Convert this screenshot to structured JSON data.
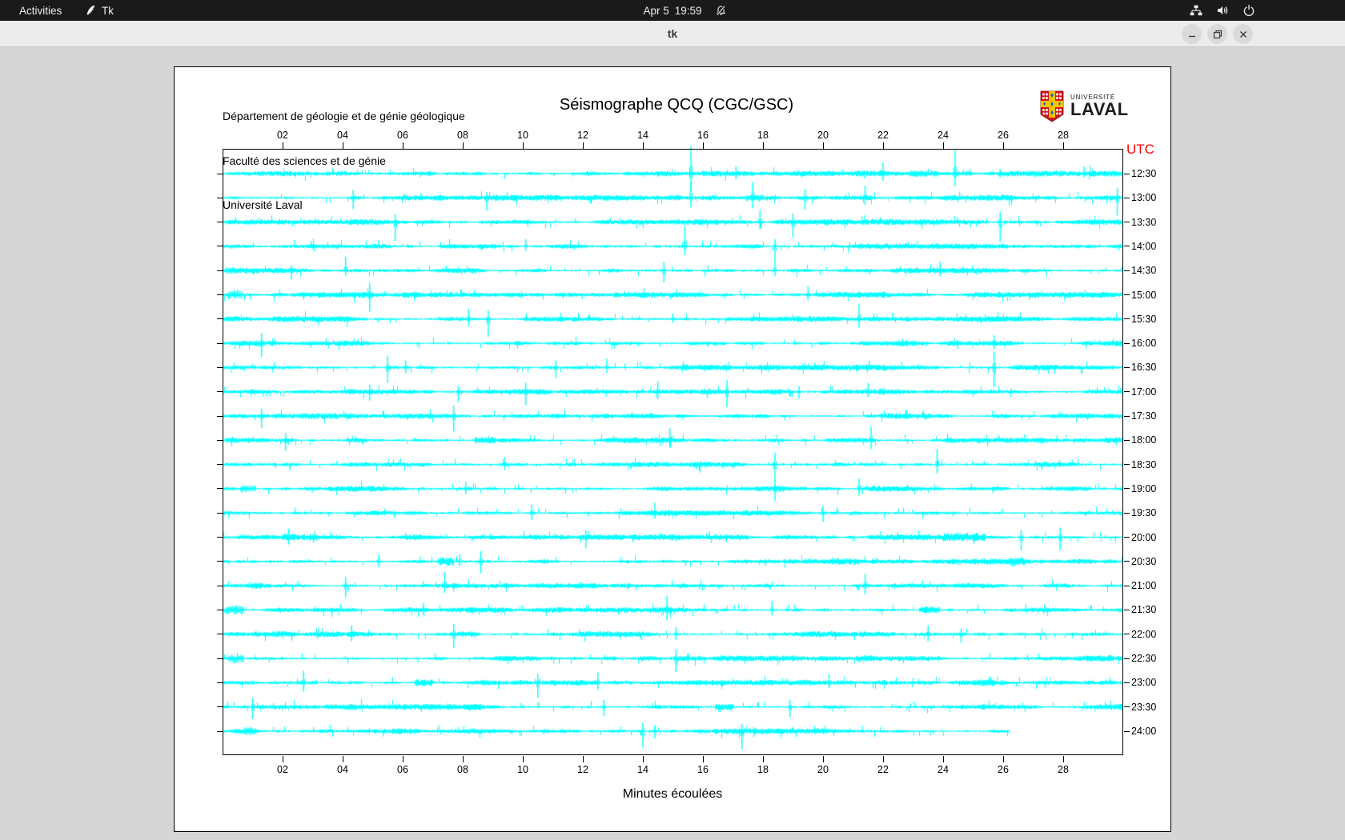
{
  "topbar": {
    "activities_label": "Activities",
    "app_indicator_label": "Tk",
    "clock_date": "Apr 5",
    "clock_time": "19:59",
    "icons": [
      "tk-feather-icon",
      "notifications-disabled-icon",
      "network-icon",
      "volume-icon",
      "power-icon"
    ]
  },
  "titlebar": {
    "title": "tk",
    "buttons": [
      "minimize",
      "maximize",
      "close"
    ]
  },
  "panel": {
    "header_lines": [
      "Département de géologie et de génie géologique",
      "Faculté des sciences et de génie",
      "Université Laval"
    ],
    "logo": {
      "university": "UNIVERSITÉ",
      "name": "LAVAL"
    },
    "title": "Séismographe QCQ (CGC/GSC)",
    "utc_label": "UTC",
    "xlabel": "Minutes écoulées"
  },
  "colors": {
    "desktop_bg": "#d6d6d6",
    "topbar_bg": "#1a1a1a",
    "titlebar_bg": "#ececec",
    "panel_bg": "#ffffff",
    "trace": "#00ffff",
    "utc_label": "#fb0007",
    "logo_red": "#d8101b",
    "logo_gold": "#f7c500",
    "logo_blue": "#1d6fb8"
  },
  "chart_data": {
    "type": "line",
    "subtype": "helicorder-seismograph",
    "title": "Séismographe QCQ (CGC/GSC)",
    "xlabel": "Minutes écoulées",
    "right_axis_label": "UTC",
    "x_range": [
      0,
      30
    ],
    "x_ticks": [
      "02",
      "04",
      "06",
      "08",
      "10",
      "12",
      "14",
      "16",
      "18",
      "20",
      "22",
      "24",
      "26",
      "28"
    ],
    "grid": false,
    "trace_color": "#00ffff",
    "noise_seed": 1234,
    "rows": [
      {
        "utc": "12:30",
        "spikes": [
          [
            15.6,
            34,
            22
          ],
          [
            17.1,
            9,
            7
          ],
          [
            22.0,
            14,
            9
          ],
          [
            24.4,
            30,
            16
          ],
          [
            25.9,
            6,
            5
          ],
          [
            28.7,
            9,
            5
          ]
        ],
        "bursts": [
          [
            22.9,
            0.9,
            4
          ]
        ]
      },
      {
        "utc": "13:00",
        "spikes": [
          [
            4.35,
            10,
            14
          ],
          [
            8.8,
            7,
            16
          ],
          [
            15.6,
            20,
            12
          ],
          [
            17.65,
            20,
            13
          ],
          [
            19.4,
            11,
            15
          ],
          [
            21.4,
            15,
            9
          ],
          [
            29.8,
            12,
            22
          ]
        ],
        "bursts": [
          [
            17.4,
            0.6,
            4
          ]
        ]
      },
      {
        "utc": "13:30",
        "spikes": [
          [
            5.75,
            10,
            24
          ],
          [
            17.9,
            15,
            9
          ],
          [
            19.0,
            11,
            19
          ],
          [
            25.9,
            13,
            25
          ]
        ],
        "bursts": []
      },
      {
        "utc": "14:00",
        "spikes": [
          [
            10.1,
            9,
            6
          ],
          [
            15.4,
            25,
            11
          ],
          [
            18.4,
            9,
            17
          ]
        ],
        "bursts": []
      },
      {
        "utc": "14:30",
        "spikes": [
          [
            2.3,
            7,
            11
          ],
          [
            4.1,
            17,
            6
          ],
          [
            14.7,
            11,
            15
          ],
          [
            18.4,
            13,
            7
          ],
          [
            23.9,
            11,
            7
          ]
        ],
        "bursts": [
          [
            0.1,
            0.5,
            4
          ]
        ]
      },
      {
        "utc": "15:00",
        "spikes": [
          [
            4.9,
            15,
            21
          ],
          [
            19.5,
            11,
            7
          ]
        ],
        "bursts": [
          [
            0.15,
            0.5,
            5
          ]
        ]
      },
      {
        "utc": "15:30",
        "spikes": [
          [
            8.2,
            13,
            9
          ],
          [
            8.85,
            11,
            22
          ],
          [
            15.0,
            7,
            5
          ],
          [
            21.2,
            19,
            11
          ]
        ],
        "bursts": []
      },
      {
        "utc": "16:00",
        "spikes": [
          [
            1.3,
            13,
            17
          ],
          [
            25.7,
            10,
            7
          ]
        ],
        "bursts": []
      },
      {
        "utc": "16:30",
        "spikes": [
          [
            5.5,
            15,
            19
          ],
          [
            6.1,
            9,
            7
          ],
          [
            11.1,
            9,
            13
          ],
          [
            12.8,
            11,
            7
          ],
          [
            25.7,
            20,
            24
          ]
        ],
        "bursts": []
      },
      {
        "utc": "17:00",
        "spikes": [
          [
            4.9,
            9,
            11
          ],
          [
            7.85,
            7,
            13
          ],
          [
            10.1,
            11,
            17
          ],
          [
            14.5,
            13,
            9
          ],
          [
            16.8,
            15,
            19
          ],
          [
            19.2,
            7,
            9
          ],
          [
            21.5,
            11,
            7
          ]
        ],
        "bursts": []
      },
      {
        "utc": "17:30",
        "spikes": [
          [
            1.3,
            9,
            15
          ],
          [
            7.7,
            13,
            19
          ]
        ],
        "bursts": []
      },
      {
        "utc": "18:00",
        "spikes": [
          [
            2.1,
            9,
            13
          ],
          [
            14.9,
            15,
            9
          ],
          [
            21.6,
            17,
            11
          ]
        ],
        "bursts": [
          [
            8.4,
            0.7,
            4
          ],
          [
            0.1,
            0.4,
            3
          ]
        ]
      },
      {
        "utc": "18:30",
        "spikes": [
          [
            9.4,
            9,
            7
          ],
          [
            18.4,
            15,
            21
          ],
          [
            23.8,
            19,
            11
          ]
        ],
        "bursts": []
      },
      {
        "utc": "19:00",
        "spikes": [
          [
            8.1,
            9,
            7
          ],
          [
            18.4,
            11,
            15
          ],
          [
            21.2,
            13,
            9
          ]
        ],
        "bursts": [
          [
            0.6,
            0.5,
            4
          ]
        ]
      },
      {
        "utc": "19:30",
        "spikes": [
          [
            10.3,
            11,
            9
          ],
          [
            14.4,
            13,
            7
          ],
          [
            20.0,
            9,
            11
          ]
        ],
        "bursts": []
      },
      {
        "utc": "20:00",
        "spikes": [
          [
            2.2,
            11,
            9
          ],
          [
            12.1,
            9,
            13
          ],
          [
            26.6,
            9,
            17
          ],
          [
            27.9,
            12,
            16
          ]
        ],
        "bursts": [
          [
            24.0,
            1.4,
            5
          ]
        ]
      },
      {
        "utc": "20:30",
        "spikes": [
          [
            5.2,
            9,
            7
          ],
          [
            7.9,
            9,
            6
          ],
          [
            8.6,
            13,
            15
          ]
        ],
        "bursts": [
          [
            7.2,
            0.5,
            5
          ],
          [
            26.2,
            0.5,
            5
          ]
        ]
      },
      {
        "utc": "21:00",
        "spikes": [
          [
            4.1,
            11,
            15
          ],
          [
            7.4,
            17,
            9
          ],
          [
            21.4,
            15,
            11
          ]
        ],
        "bursts": []
      },
      {
        "utc": "21:30",
        "spikes": [
          [
            6.7,
            9,
            7
          ],
          [
            14.8,
            17,
            13
          ],
          [
            18.3,
            11,
            7
          ]
        ],
        "bursts": [
          [
            0.1,
            0.6,
            5
          ],
          [
            23.2,
            0.7,
            4
          ]
        ]
      },
      {
        "utc": "22:00",
        "spikes": [
          [
            4.3,
            11,
            9
          ],
          [
            7.7,
            13,
            17
          ],
          [
            15.1,
            9,
            7
          ],
          [
            23.5,
            11,
            9
          ],
          [
            24.6,
            7,
            11
          ]
        ],
        "bursts": []
      },
      {
        "utc": "22:30",
        "spikes": [
          [
            15.1,
            11,
            17
          ],
          [
            15.5,
            7,
            5
          ]
        ],
        "bursts": [
          [
            0.2,
            0.5,
            5
          ],
          [
            21.1,
            0.6,
            4
          ]
        ]
      },
      {
        "utc": "23:00",
        "spikes": [
          [
            2.7,
            15,
            11
          ],
          [
            10.5,
            11,
            19
          ],
          [
            12.5,
            13,
            9
          ],
          [
            20.2,
            11,
            7
          ]
        ],
        "bursts": [
          [
            6.4,
            0.6,
            4
          ],
          [
            25.0,
            0.7,
            4
          ]
        ]
      },
      {
        "utc": "23:30",
        "spikes": [
          [
            1.0,
            11,
            15
          ],
          [
            12.7,
            9,
            11
          ],
          [
            18.9,
            9,
            13
          ]
        ],
        "bursts": [
          [
            8.0,
            0.6,
            4
          ],
          [
            16.4,
            0.6,
            4
          ]
        ]
      },
      {
        "utc": "24:00",
        "end": 26.2,
        "spikes": [
          [
            14.0,
            11,
            21
          ],
          [
            14.4,
            7,
            9
          ],
          [
            17.3,
            9,
            23
          ],
          [
            17.7,
            5,
            7
          ]
        ],
        "bursts": [
          [
            0.7,
            0.4,
            5
          ]
        ]
      }
    ]
  }
}
